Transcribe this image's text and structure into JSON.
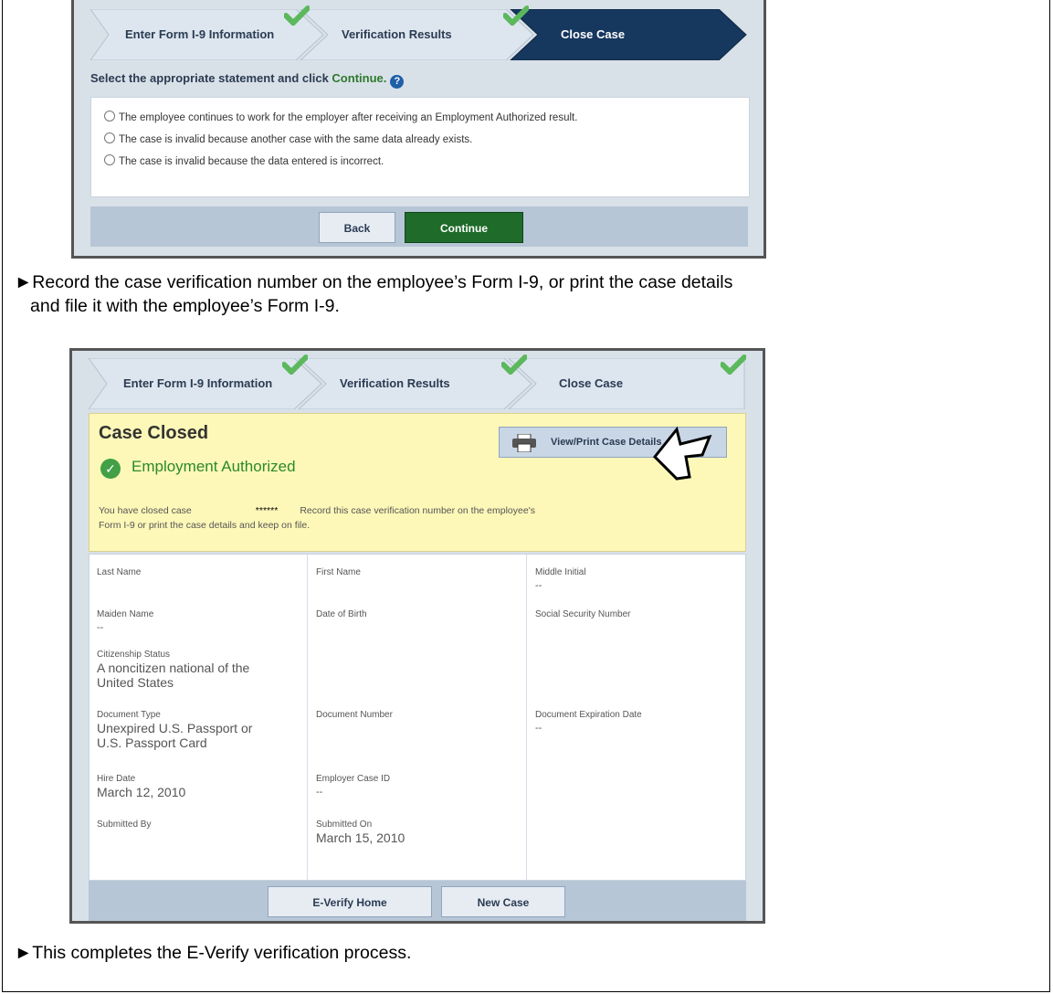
{
  "steps": [
    "Enter Form I-9 Information",
    "Verification Results",
    "Close Case"
  ],
  "screen1": {
    "instruction_prefix": "Select the appropriate statement and click ",
    "instruction_link": "Continue.",
    "help_icon": "?",
    "options": [
      "The employee continues to work for the employer after receiving an Employment Authorized result.",
      "The case is invalid because another case with the same data already exists.",
      "The case is invalid because the data entered is incorrect."
    ],
    "back_label": "Back",
    "continue_label": "Continue"
  },
  "bullets": {
    "record_line1": "►Record the case verification number on the employee’s Form I-9, or print the case details",
    "record_line2": "and file it with the employee’s Form I-9.",
    "complete": "►This completes the E-Verify verification process."
  },
  "screen2": {
    "case_title": "Case Closed",
    "auth_status": "Employment Authorized",
    "closed_text_a": "You have closed case",
    "case_number": "******",
    "closed_text_b": "Record this case verification number on the employee's",
    "closed_text_c": "Form I-9 or print the case details and keep on file.",
    "print_label": "View/Print Case Details",
    "fields": {
      "last_name": {
        "label": "Last Name",
        "value": ""
      },
      "first_name": {
        "label": "First Name",
        "value": ""
      },
      "middle_initial": {
        "label": "Middle Initial",
        "value": "--"
      },
      "maiden_name": {
        "label": "Maiden Name",
        "value": "--"
      },
      "dob": {
        "label": "Date of Birth",
        "value": ""
      },
      "ssn": {
        "label": "Social Security Number",
        "value": ""
      },
      "citizenship": {
        "label": "Citizenship Status",
        "value": "A noncitizen national of the United States"
      },
      "doc_type": {
        "label": "Document Type",
        "value": "Unexpired U.S. Passport or U.S. Passport Card"
      },
      "doc_number": {
        "label": "Document Number",
        "value": ""
      },
      "doc_exp": {
        "label": "Document Expiration Date",
        "value": "--"
      },
      "hire_date": {
        "label": "Hire Date",
        "value": "March 12, 2010"
      },
      "employer_case_id": {
        "label": "Employer Case ID",
        "value": "--"
      },
      "submitted_by": {
        "label": "Submitted By",
        "value": ""
      },
      "submitted_on": {
        "label": "Submitted On",
        "value": "March 15, 2010"
      }
    },
    "home_label": "E-Verify Home",
    "new_case_label": "New Case"
  },
  "colors": {
    "step_bg": "#dde6ef",
    "step_active": "#16375e",
    "check_green": "#5cb85c",
    "continue_green": "#1f6b2a",
    "case_box_yellow": "#fdf8b8"
  }
}
